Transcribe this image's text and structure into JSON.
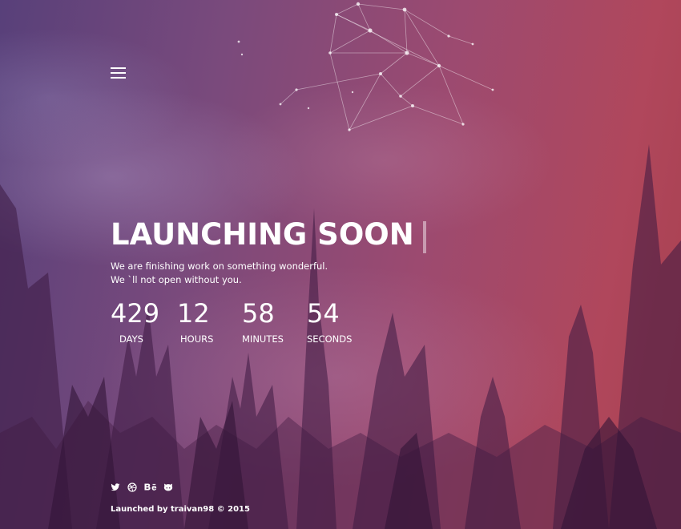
{
  "menu": {
    "icon": "hamburger-menu-icon"
  },
  "hero": {
    "title": "LAUNCHING SOON",
    "subtitle_line1": "We are finishing work on something wonderful.",
    "subtitle_line2": "We `ll not open without you."
  },
  "countdown": {
    "days": {
      "value": "429",
      "label": "DAYS"
    },
    "hours": {
      "value": "12",
      "label": "HOURS"
    },
    "minutes": {
      "value": "58",
      "label": "MINUTES"
    },
    "seconds": {
      "value": "54",
      "label": "SECONDS"
    }
  },
  "social": [
    {
      "icon": "twitter-icon"
    },
    {
      "icon": "dribbble-icon"
    },
    {
      "icon": "behance-icon"
    },
    {
      "icon": "github-icon"
    }
  ],
  "footer": {
    "text": "Launched by traivan98 © 2015"
  },
  "colors": {
    "gradient_left": "#58407a",
    "gradient_mid": "#9c4a70",
    "gradient_right": "#b0475c",
    "text": "#ffffff"
  }
}
